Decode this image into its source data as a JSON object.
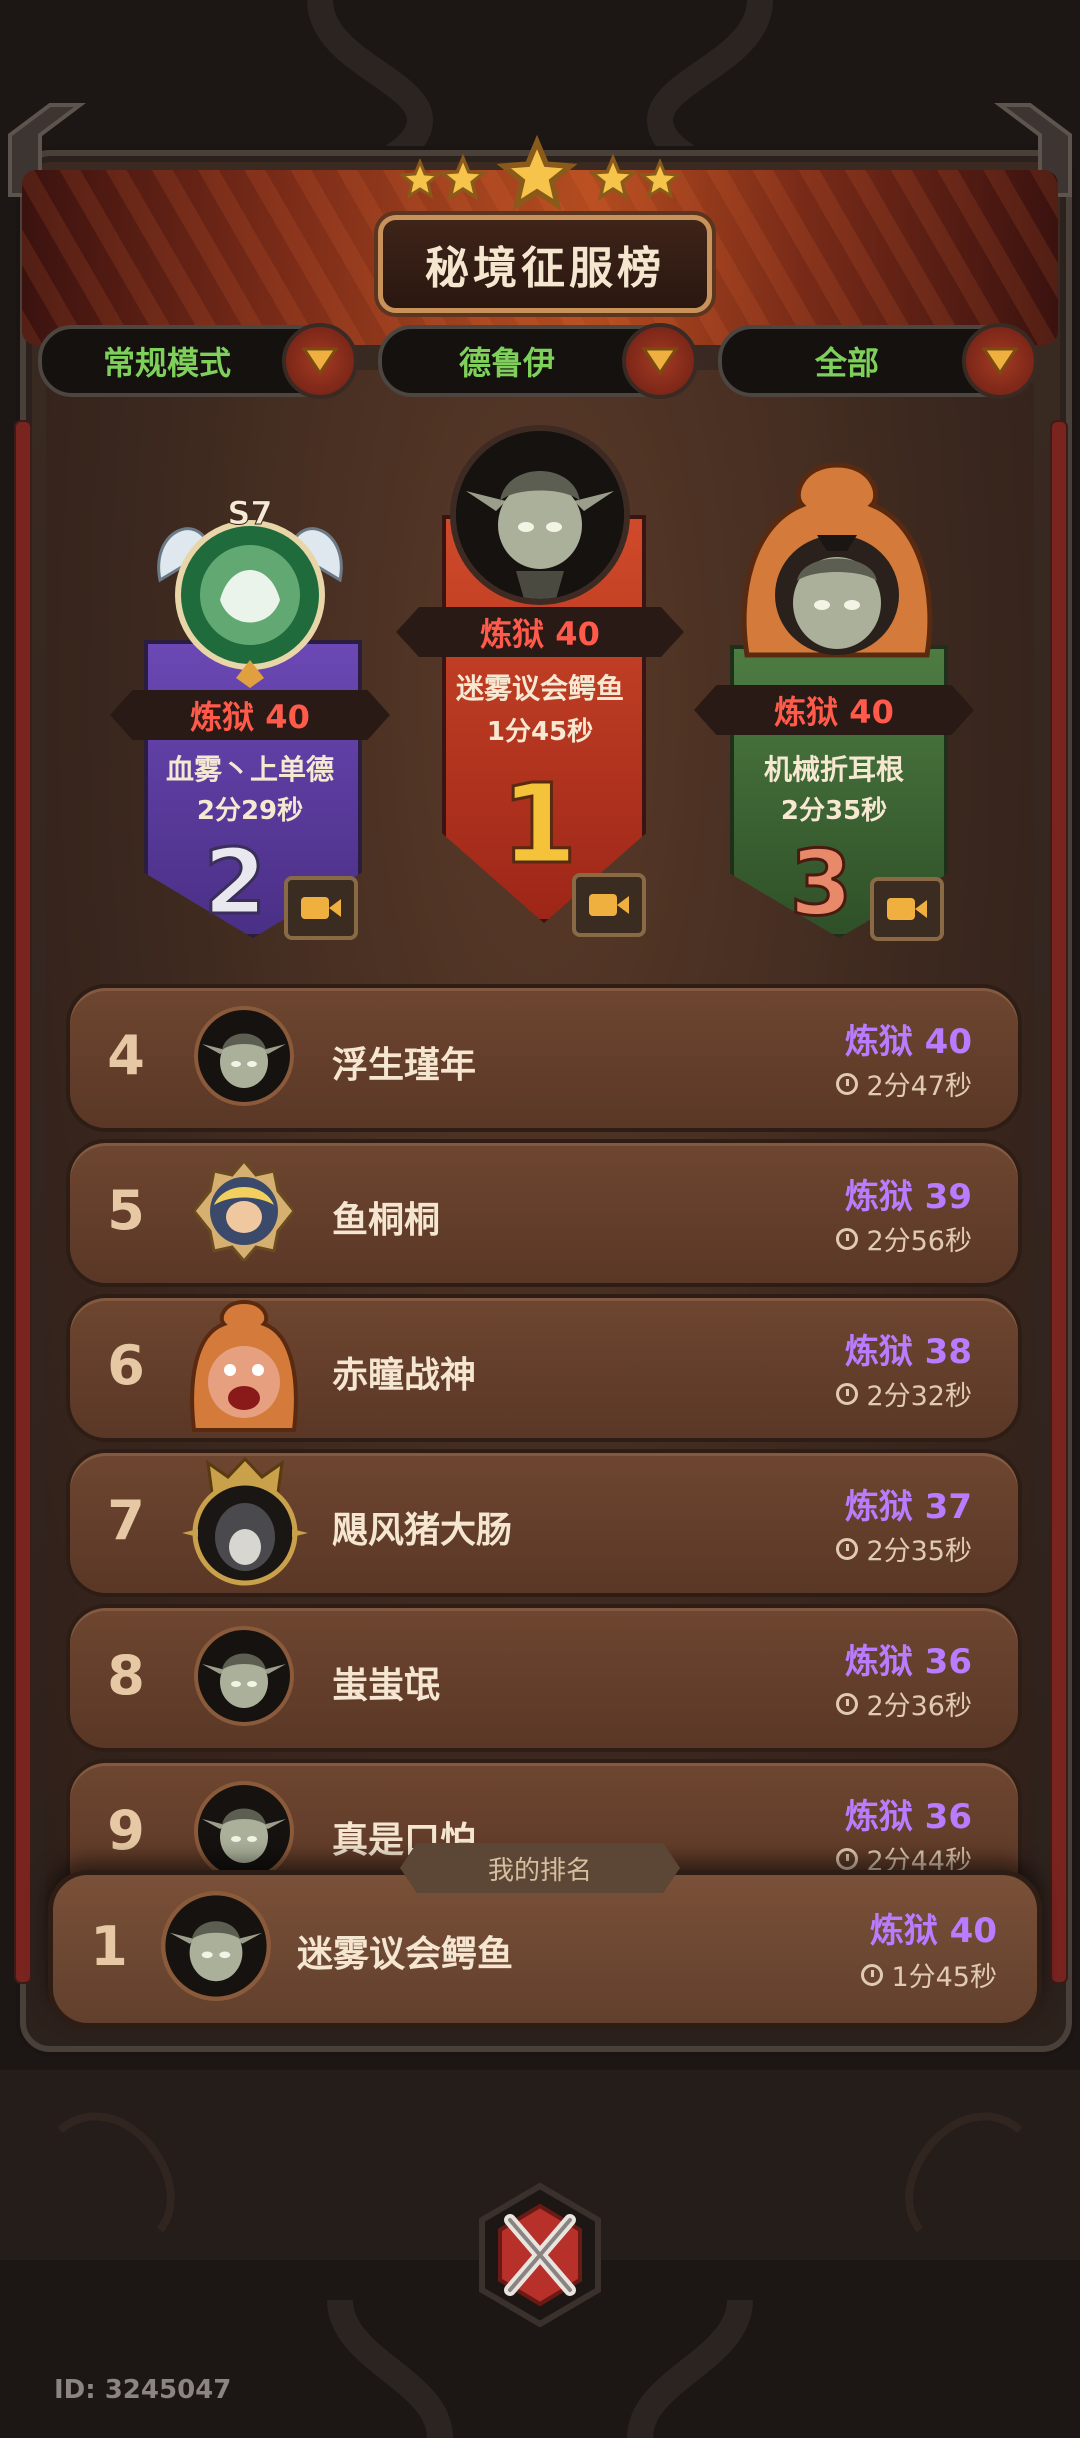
{
  "header": {
    "title": "秘境征服榜",
    "star_count": 5
  },
  "filters": [
    {
      "label": "常规模式"
    },
    {
      "label": "德鲁伊"
    },
    {
      "label": "全部"
    }
  ],
  "podium": {
    "first": {
      "rank": "1",
      "level": "炼狱 40",
      "name": "迷雾议会鳄鱼",
      "time": "1分45秒"
    },
    "second": {
      "rank": "2",
      "level": "炼狱 40",
      "name": "血雾丶上单德",
      "time": "2分29秒",
      "season": "S7"
    },
    "third": {
      "rank": "3",
      "level": "炼狱 40",
      "name": "机械折耳根",
      "time": "2分35秒"
    }
  },
  "list": [
    {
      "rank": "4",
      "name": "浮生瑾年",
      "level": "炼狱 40",
      "time": "2分47秒",
      "avatar": "goblin-avatar"
    },
    {
      "rank": "5",
      "name": "鱼桐桐",
      "level": "炼狱 39",
      "time": "2分56秒",
      "avatar": "blonde-hero-avatar"
    },
    {
      "rank": "6",
      "name": "赤瞳战神",
      "level": "炼狱 38",
      "time": "2分32秒",
      "avatar": "shouting-boar-avatar"
    },
    {
      "rank": "7",
      "name": "飓风猪大肠",
      "level": "炼狱 37",
      "time": "2分35秒",
      "avatar": "hooded-dragon-avatar"
    },
    {
      "rank": "8",
      "name": "蚩蚩氓",
      "level": "炼狱 36",
      "time": "2分36秒",
      "avatar": "goblin-avatar"
    },
    {
      "rank": "9",
      "name": "真是口怕",
      "level": "炼狱 36",
      "time": "2分44秒",
      "avatar": "goblin-avatar"
    }
  ],
  "my_rank": {
    "tab_label": "我的排名",
    "rank": "1",
    "name": "迷雾议会鳄鱼",
    "level": "炼狱 40",
    "time": "1分45秒"
  },
  "footer": {
    "id_text": "ID: 3245047"
  },
  "colors": {
    "filter_text": "#7ed05a",
    "level_purple": "#b97cff",
    "level_red": "#ff5a4a",
    "first_shield": "#b8301f",
    "second_shield": "#5a3a9e",
    "third_shield": "#3e6a36"
  }
}
